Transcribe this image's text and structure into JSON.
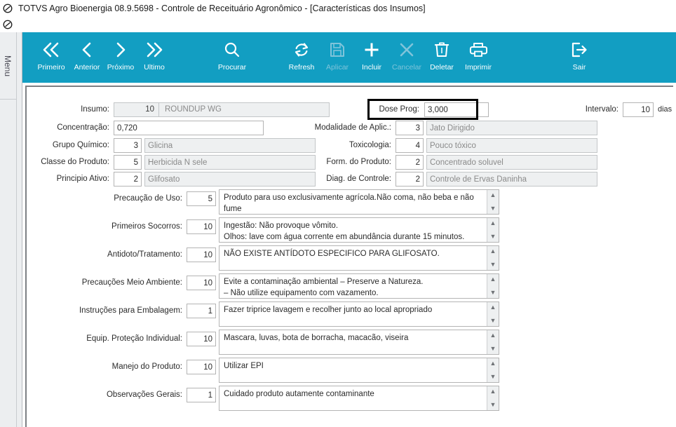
{
  "window": {
    "title": "TOTVS Agro Bioenergia 08.9.5698 - Controle de Receituário Agronômico - [Características dos Insumos]",
    "sysicon": "prohibition-icon"
  },
  "sidebar": {
    "menu_label": "Menu"
  },
  "toolbar": {
    "buttons": [
      {
        "label": "Primeiro",
        "icon": "double-chevron-left-icon",
        "disabled": false
      },
      {
        "label": "Anterior",
        "icon": "chevron-left-icon",
        "disabled": false
      },
      {
        "label": "Próximo",
        "icon": "chevron-right-icon",
        "disabled": false
      },
      {
        "label": "Ultimo",
        "icon": "double-chevron-right-icon",
        "disabled": false
      },
      {
        "label": "Procurar",
        "icon": "search-icon",
        "disabled": false
      },
      {
        "label": "Refresh",
        "icon": "refresh-icon",
        "disabled": false
      },
      {
        "label": "Aplicar",
        "icon": "save-icon",
        "disabled": true
      },
      {
        "label": "Incluir",
        "icon": "plus-icon",
        "disabled": false
      },
      {
        "label": "Cancelar",
        "icon": "close-x-icon",
        "disabled": true
      },
      {
        "label": "Deletar",
        "icon": "trash-icon",
        "disabled": false
      },
      {
        "label": "Imprimir",
        "icon": "printer-icon",
        "disabled": false
      },
      {
        "label": "Sair",
        "icon": "exit-icon",
        "disabled": false
      }
    ]
  },
  "form": {
    "insumo": {
      "label": "Insumo:",
      "code": "10",
      "text": "ROUNDUP WG"
    },
    "dose_prog": {
      "label": "Dose Prog:",
      "value": "3,000",
      "highlighted": true
    },
    "intervalo": {
      "label": "Intervalo:",
      "value": "10",
      "suffix": "dias"
    },
    "concentracao": {
      "label": "Concentração:",
      "value": "0,720"
    },
    "grupo_quimico": {
      "label": "Grupo Químico:",
      "code": "3",
      "text": "Glicina"
    },
    "classe_produto": {
      "label": "Classe do Produto:",
      "code": "5",
      "text": "Herbicida N sele"
    },
    "principio_ativo": {
      "label": "Principio Ativo:",
      "code": "2",
      "text": "Glifosato"
    },
    "modalidade": {
      "label": "Modalidade de Aplic.:",
      "code": "3",
      "text": "Jato Dirigido"
    },
    "toxicologia": {
      "label": "Toxicologia:",
      "code": "4",
      "text": "Pouco tóxico"
    },
    "form_produto": {
      "label": "Form. do Produto:",
      "code": "2",
      "text": "Concentrado soluvel"
    },
    "diag_controle": {
      "label": "Diag. de Controle:",
      "code": "2",
      "text": "Controle de Ervas Daninha"
    }
  },
  "memos": [
    {
      "label": "Precaução de Uso:",
      "code": "5",
      "text": "Produto para uso exclusivamente agrícola.Não coma, não beba e não fume\ndurante o manuseio e aplicação do produto."
    },
    {
      "label": "Primeiros Socorros:",
      "code": "10",
      "text": "Ingestão: Não provoque vômito.\nOlhos: lave com água corrente em abundância durante 15 minutos."
    },
    {
      "label": "Antidoto/Tratamento:",
      "code": "10",
      "text": "NÃO EXISTE ANTÍDOTO ESPECIFICO PARA GLIFOSATO."
    },
    {
      "label": "Precauções Meio Ambiente:",
      "code": "10",
      "text": "Evite a contaminação ambiental – Preserve a Natureza.\n– Não utilize equipamento com vazamento."
    },
    {
      "label": "Instruções para Embalagem:",
      "code": "1",
      "text": "Fazer triprice lavagem e recolher junto ao local apropriado"
    },
    {
      "label": "Equip. Proteção Individual:",
      "code": "10",
      "text": "Mascara, luvas, bota de borracha, macacão, viseira"
    },
    {
      "label": "Manejo do Produto:",
      "code": "10",
      "text": "Utilizar EPI"
    },
    {
      "label": "Observações Gerais:",
      "code": "1",
      "text": "Cuidado produto autamente contaminante"
    }
  ],
  "scroll": {
    "up": "▲",
    "down": "▼"
  },
  "colors": {
    "toolbar": "#129ec2",
    "toolbar_disabled_text": "#7fc4da",
    "chrome_grey": "#eceef0",
    "highlight_border": "#000000"
  }
}
